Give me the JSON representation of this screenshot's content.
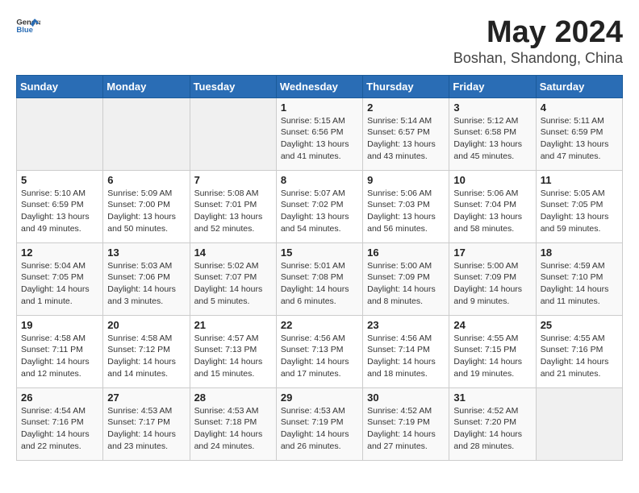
{
  "header": {
    "logo_general": "General",
    "logo_blue": "Blue",
    "title": "May 2024",
    "subtitle": "Boshan, Shandong, China"
  },
  "days_of_week": [
    "Sunday",
    "Monday",
    "Tuesday",
    "Wednesday",
    "Thursday",
    "Friday",
    "Saturday"
  ],
  "weeks": [
    [
      {
        "day": "",
        "info": ""
      },
      {
        "day": "",
        "info": ""
      },
      {
        "day": "",
        "info": ""
      },
      {
        "day": "1",
        "info": "Sunrise: 5:15 AM\nSunset: 6:56 PM\nDaylight: 13 hours and 41 minutes."
      },
      {
        "day": "2",
        "info": "Sunrise: 5:14 AM\nSunset: 6:57 PM\nDaylight: 13 hours and 43 minutes."
      },
      {
        "day": "3",
        "info": "Sunrise: 5:12 AM\nSunset: 6:58 PM\nDaylight: 13 hours and 45 minutes."
      },
      {
        "day": "4",
        "info": "Sunrise: 5:11 AM\nSunset: 6:59 PM\nDaylight: 13 hours and 47 minutes."
      }
    ],
    [
      {
        "day": "5",
        "info": "Sunrise: 5:10 AM\nSunset: 6:59 PM\nDaylight: 13 hours and 49 minutes."
      },
      {
        "day": "6",
        "info": "Sunrise: 5:09 AM\nSunset: 7:00 PM\nDaylight: 13 hours and 50 minutes."
      },
      {
        "day": "7",
        "info": "Sunrise: 5:08 AM\nSunset: 7:01 PM\nDaylight: 13 hours and 52 minutes."
      },
      {
        "day": "8",
        "info": "Sunrise: 5:07 AM\nSunset: 7:02 PM\nDaylight: 13 hours and 54 minutes."
      },
      {
        "day": "9",
        "info": "Sunrise: 5:06 AM\nSunset: 7:03 PM\nDaylight: 13 hours and 56 minutes."
      },
      {
        "day": "10",
        "info": "Sunrise: 5:06 AM\nSunset: 7:04 PM\nDaylight: 13 hours and 58 minutes."
      },
      {
        "day": "11",
        "info": "Sunrise: 5:05 AM\nSunset: 7:05 PM\nDaylight: 13 hours and 59 minutes."
      }
    ],
    [
      {
        "day": "12",
        "info": "Sunrise: 5:04 AM\nSunset: 7:05 PM\nDaylight: 14 hours and 1 minute."
      },
      {
        "day": "13",
        "info": "Sunrise: 5:03 AM\nSunset: 7:06 PM\nDaylight: 14 hours and 3 minutes."
      },
      {
        "day": "14",
        "info": "Sunrise: 5:02 AM\nSunset: 7:07 PM\nDaylight: 14 hours and 5 minutes."
      },
      {
        "day": "15",
        "info": "Sunrise: 5:01 AM\nSunset: 7:08 PM\nDaylight: 14 hours and 6 minutes."
      },
      {
        "day": "16",
        "info": "Sunrise: 5:00 AM\nSunset: 7:09 PM\nDaylight: 14 hours and 8 minutes."
      },
      {
        "day": "17",
        "info": "Sunrise: 5:00 AM\nSunset: 7:09 PM\nDaylight: 14 hours and 9 minutes."
      },
      {
        "day": "18",
        "info": "Sunrise: 4:59 AM\nSunset: 7:10 PM\nDaylight: 14 hours and 11 minutes."
      }
    ],
    [
      {
        "day": "19",
        "info": "Sunrise: 4:58 AM\nSunset: 7:11 PM\nDaylight: 14 hours and 12 minutes."
      },
      {
        "day": "20",
        "info": "Sunrise: 4:58 AM\nSunset: 7:12 PM\nDaylight: 14 hours and 14 minutes."
      },
      {
        "day": "21",
        "info": "Sunrise: 4:57 AM\nSunset: 7:13 PM\nDaylight: 14 hours and 15 minutes."
      },
      {
        "day": "22",
        "info": "Sunrise: 4:56 AM\nSunset: 7:13 PM\nDaylight: 14 hours and 17 minutes."
      },
      {
        "day": "23",
        "info": "Sunrise: 4:56 AM\nSunset: 7:14 PM\nDaylight: 14 hours and 18 minutes."
      },
      {
        "day": "24",
        "info": "Sunrise: 4:55 AM\nSunset: 7:15 PM\nDaylight: 14 hours and 19 minutes."
      },
      {
        "day": "25",
        "info": "Sunrise: 4:55 AM\nSunset: 7:16 PM\nDaylight: 14 hours and 21 minutes."
      }
    ],
    [
      {
        "day": "26",
        "info": "Sunrise: 4:54 AM\nSunset: 7:16 PM\nDaylight: 14 hours and 22 minutes."
      },
      {
        "day": "27",
        "info": "Sunrise: 4:53 AM\nSunset: 7:17 PM\nDaylight: 14 hours and 23 minutes."
      },
      {
        "day": "28",
        "info": "Sunrise: 4:53 AM\nSunset: 7:18 PM\nDaylight: 14 hours and 24 minutes."
      },
      {
        "day": "29",
        "info": "Sunrise: 4:53 AM\nSunset: 7:19 PM\nDaylight: 14 hours and 26 minutes."
      },
      {
        "day": "30",
        "info": "Sunrise: 4:52 AM\nSunset: 7:19 PM\nDaylight: 14 hours and 27 minutes."
      },
      {
        "day": "31",
        "info": "Sunrise: 4:52 AM\nSunset: 7:20 PM\nDaylight: 14 hours and 28 minutes."
      },
      {
        "day": "",
        "info": ""
      }
    ]
  ]
}
